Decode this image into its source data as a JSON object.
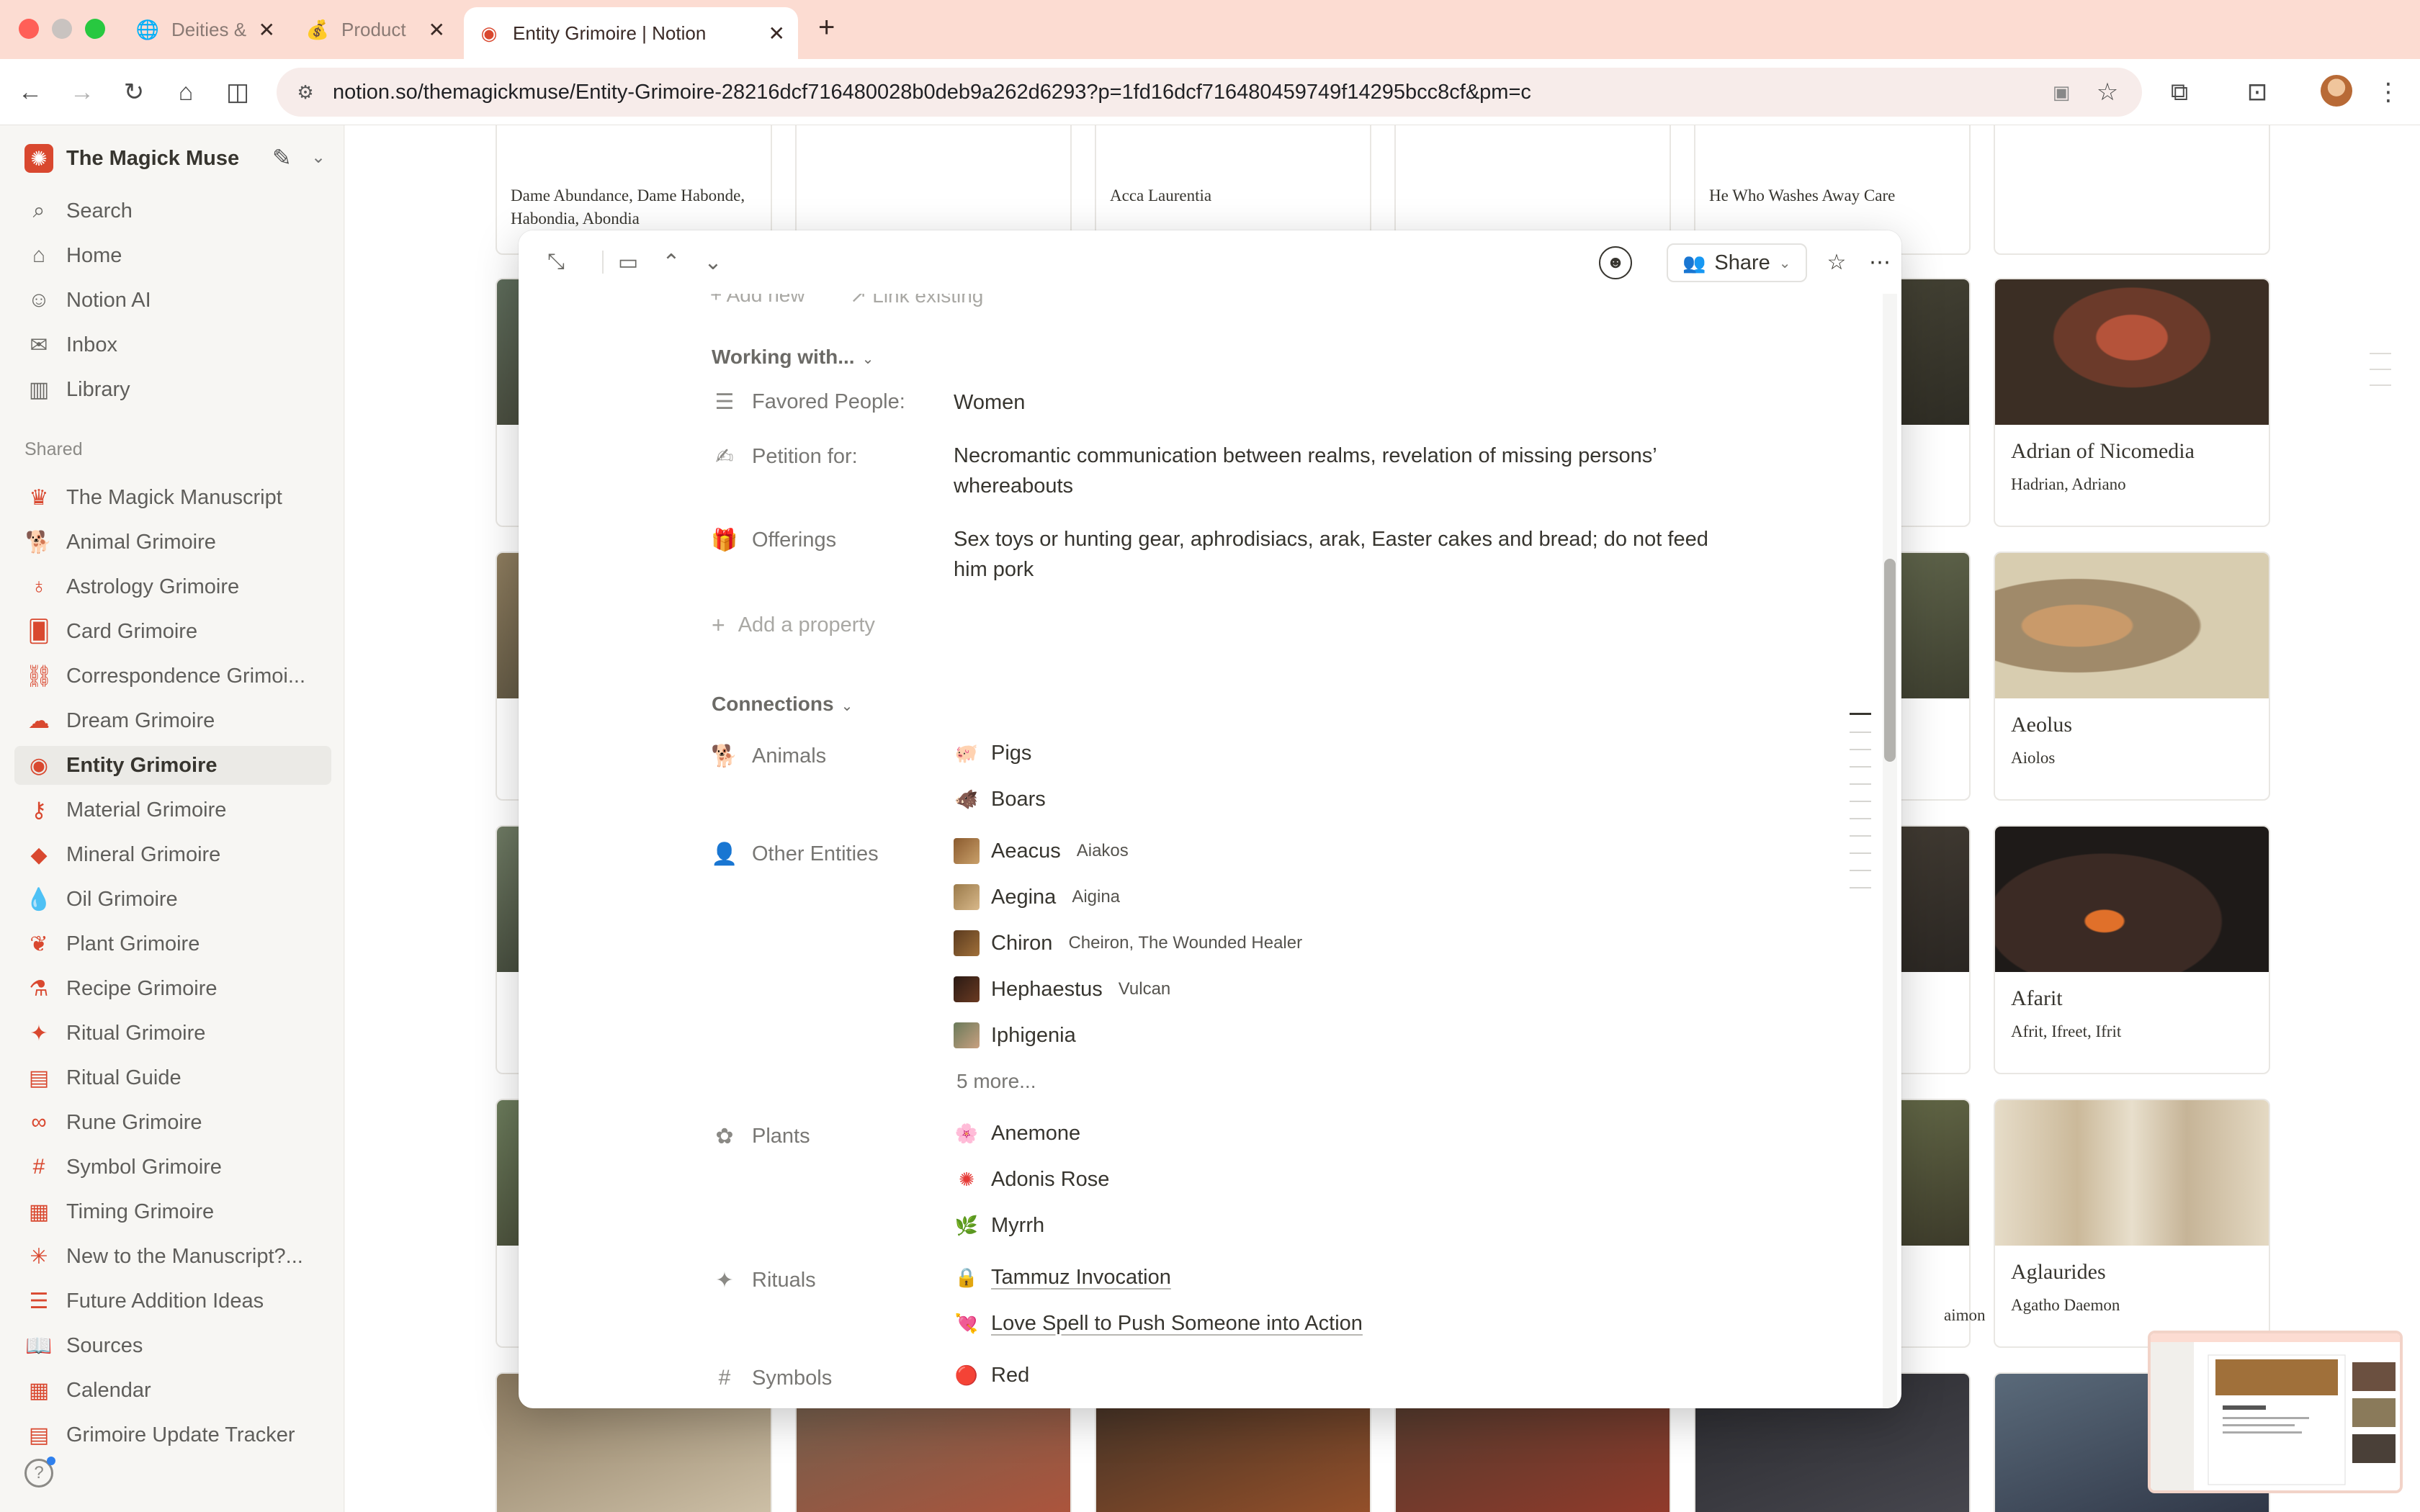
{
  "browser": {
    "tabs": [
      {
        "label": "Deities &",
        "favicon": "globe-icon"
      },
      {
        "label": "Product",
        "favicon": "money-bag-icon"
      },
      {
        "label": "Entity Grimoire | Notion",
        "favicon": "eye-icon"
      }
    ],
    "url": "notion.so/themagickmuse/Entity-Grimoire-28216dcf716480028b0deb9a262d6293?p=1fd16dcf716480459749f14295bcc8cf&pm=c"
  },
  "sidebar": {
    "workspace": "The Magick Muse",
    "top_items": [
      {
        "label": "Search",
        "icon": "search-icon"
      },
      {
        "label": "Home",
        "icon": "home-icon"
      },
      {
        "label": "Notion AI",
        "icon": "ai-face-icon"
      },
      {
        "label": "Inbox",
        "icon": "inbox-icon"
      },
      {
        "label": "Library",
        "icon": "library-icon"
      }
    ],
    "shared_label": "Shared",
    "shared_items": [
      {
        "label": "The Magick Manuscript",
        "icon": "crown-icon"
      },
      {
        "label": "Animal Grimoire",
        "icon": "dog-icon"
      },
      {
        "label": "Astrology Grimoire",
        "icon": "planet-icon"
      },
      {
        "label": "Card Grimoire",
        "icon": "cards-icon"
      },
      {
        "label": "Correspondence Grimoi...",
        "icon": "link-icon"
      },
      {
        "label": "Dream Grimoire",
        "icon": "cloud-icon"
      },
      {
        "label": "Entity Grimoire",
        "icon": "eye-icon"
      },
      {
        "label": "Material Grimoire",
        "icon": "key-icon"
      },
      {
        "label": "Mineral Grimoire",
        "icon": "gem-icon"
      },
      {
        "label": "Oil Grimoire",
        "icon": "drop-icon"
      },
      {
        "label": "Plant Grimoire",
        "icon": "leaf-icon"
      },
      {
        "label": "Recipe Grimoire",
        "icon": "flask-icon"
      },
      {
        "label": "Ritual Grimoire",
        "icon": "wand-icon"
      },
      {
        "label": "Ritual Guide",
        "icon": "book-icon"
      },
      {
        "label": "Rune Grimoire",
        "icon": "infinity-icon"
      },
      {
        "label": "Symbol Grimoire",
        "icon": "hash-icon"
      },
      {
        "label": "Timing Grimoire",
        "icon": "calendar-icon"
      },
      {
        "label": "New to the Manuscript?...",
        "icon": "sparkle-icon"
      },
      {
        "label": "Future Addition Ideas",
        "icon": "list-icon"
      },
      {
        "label": "Sources",
        "icon": "open-book-icon"
      },
      {
        "label": "Calendar",
        "icon": "calendar-icon"
      },
      {
        "label": "Grimoire Update Tracker",
        "icon": "table-icon"
      }
    ]
  },
  "gallery": {
    "top_texts": [
      "Dame Abundance, Dame Habonde, Habondia, Abondia",
      "Acca Laurentia",
      "He Who Washes Away Care"
    ],
    "cards": [
      {
        "title": "Adrian of Nicomedia",
        "subtitle": "Hadrian, Adriano"
      },
      {
        "title": "Aeolus",
        "subtitle": "Aiolos"
      },
      {
        "title": "Afarit",
        "subtitle": "Afrit, Ifreet, Ifrit"
      },
      {
        "title": "Aglaurides",
        "subtitle": "Agatho Daemon"
      }
    ],
    "fragment": "aimon"
  },
  "modal": {
    "share_label": "Share",
    "faint_top": {
      "add_new": "Add new",
      "link_existing": "Link existing"
    },
    "working_with": {
      "heading": "Working with...",
      "properties": [
        {
          "label": "Favored People:",
          "value": "Women",
          "icon": "text-lines-icon"
        },
        {
          "label": "Petition for:",
          "value": "Necromantic communication between realms, revelation of missing persons’ whereabouts",
          "icon": "edit-lines-icon"
        },
        {
          "label": "Offerings",
          "value": "Sex toys or hunting gear, aphrodisiacs, arak, Easter cakes and bread; do not feed him pork",
          "icon": "gift-icon"
        }
      ],
      "add_property": "Add a property"
    },
    "connections": {
      "heading": "Connections",
      "animals_label": "Animals",
      "animals": [
        "Pigs",
        "Boars"
      ],
      "entities_label": "Other Entities",
      "entities": [
        {
          "name": "Aeacus",
          "alias": "Aiakos"
        },
        {
          "name": "Aegina",
          "alias": "Aigina"
        },
        {
          "name": "Chiron",
          "alias": "Cheiron, The Wounded Healer"
        },
        {
          "name": "Hephaestus",
          "alias": "Vulcan"
        },
        {
          "name": "Iphigenia",
          "alias": ""
        }
      ],
      "more": "5 more...",
      "plants_label": "Plants",
      "plants": [
        "Anemone",
        "Adonis Rose",
        "Myrrh"
      ],
      "rituals_label": "Rituals",
      "rituals": [
        "Tammuz Invocation",
        "Love Spell to Push Someone into Action"
      ],
      "symbols_label": "Symbols",
      "symbols": [
        "Red"
      ]
    }
  },
  "colors": {
    "accent": "#d9482f",
    "tabbar": "#fcdcd2",
    "sidebar_bg": "#f7f6f3"
  }
}
